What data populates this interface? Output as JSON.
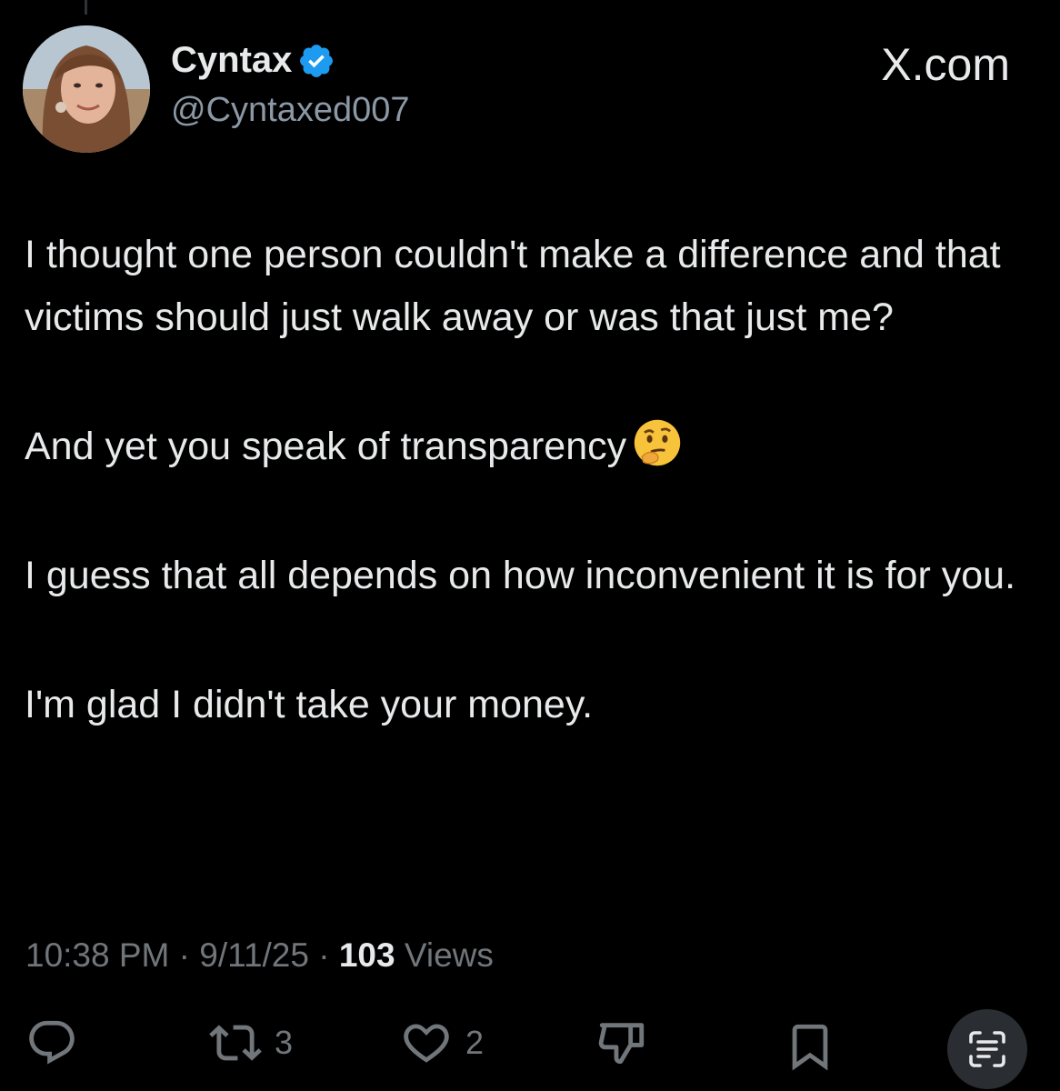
{
  "author": {
    "display_name": "Cyntax",
    "handle": "@Cyntaxed007",
    "verified": true,
    "avatar_icon": "profile-photo"
  },
  "brand": "X.com",
  "tweet": {
    "paragraphs": [
      "I thought one person couldn't make a difference and that victims should just walk away or was that just me?",
      "And yet you speak of transparency",
      "I guess that all depends on how inconvenient it is for you.",
      "I'm glad I didn't take your money."
    ],
    "emoji": "thinking-face"
  },
  "meta": {
    "time": "10:38 PM",
    "separator": "·",
    "date": "9/11/25",
    "views_count": "103",
    "views_label": "Views"
  },
  "actions": {
    "reply_icon": "comment-icon",
    "retweet_count": "3",
    "like_count": "2",
    "dislike_icon": "thumbs-down-icon",
    "bookmark_icon": "bookmark-icon",
    "share_icon": "text-scan-icon"
  },
  "colors": {
    "background": "#000000",
    "text": "#e7e9ea",
    "secondary": "#71767b",
    "verified": "#1d9bf0"
  }
}
